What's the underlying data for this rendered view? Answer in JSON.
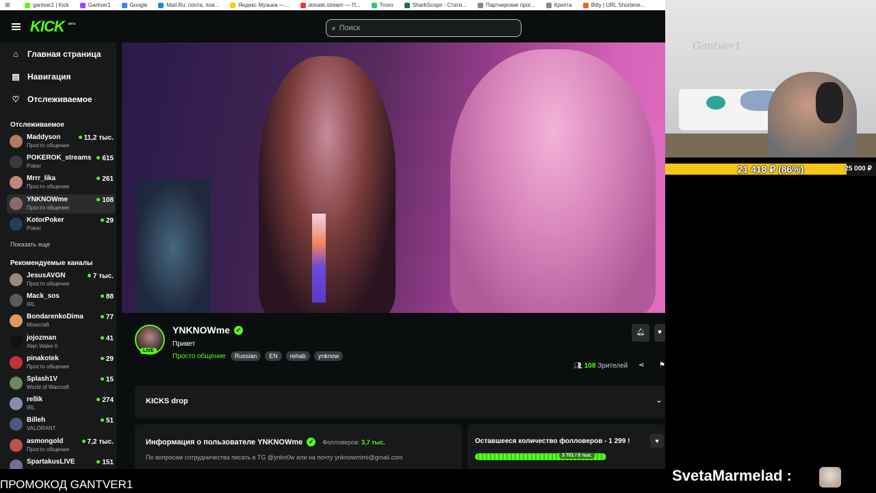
{
  "bookmarks": [
    {
      "label": "gantver1 | Kick",
      "color": "#53fc18"
    },
    {
      "label": "Gantver1",
      "color": "#9146ff"
    },
    {
      "label": "Google",
      "color": "#4285f4"
    },
    {
      "label": "Mail.Ru: почта, пои...",
      "color": "#168de2"
    },
    {
      "label": "Яндекс Музыка —...",
      "color": "#ffcc00"
    },
    {
      "label": "donate.stream — П...",
      "color": "#e53935"
    },
    {
      "label": "Trovo",
      "color": "#19d66b"
    },
    {
      "label": "SharkScope - Стати...",
      "color": "#1f6f3f"
    },
    {
      "label": "Партнерские прог...",
      "color": "#888888"
    },
    {
      "label": "Крипта",
      "color": "#888888"
    },
    {
      "label": "Bitly | URL Shortene...",
      "color": "#ee6123"
    }
  ],
  "kick": {
    "logo": "KICK",
    "beta": "BETA",
    "search_placeholder": "Поиск",
    "nav": [
      {
        "label": "Главная страница",
        "icon": "home-icon"
      },
      {
        "label": "Навигация",
        "icon": "browse-icon"
      },
      {
        "label": "Отслеживаемое",
        "icon": "heart-icon"
      }
    ],
    "following_title": "Отслеживаемое",
    "following": [
      {
        "name": "Maddyson",
        "category": "Просто общение",
        "viewers": "11,2 тыс.",
        "color": "#b07b5e"
      },
      {
        "name": "POKEROK_streams",
        "category": "Poker",
        "viewers": "615",
        "color": "#3a3a3a"
      },
      {
        "name": "Mrrr_lika",
        "category": "Просто общение",
        "viewers": "261",
        "color": "#c4847a"
      },
      {
        "name": "YNKNOWme",
        "category": "Просто общение",
        "viewers": "108",
        "color": "#8a6a6a"
      },
      {
        "name": "KotorPoker",
        "category": "Poker",
        "viewers": "29",
        "color": "#2a3a5a"
      }
    ],
    "show_more": "Показать еще",
    "recommended_title": "Рекомендуемые каналы",
    "recommended": [
      {
        "name": "JesusAVGN",
        "category": "Просто общение",
        "viewers": "7 тыс.",
        "color": "#9a8a7a"
      },
      {
        "name": "Mack_sos",
        "category": "IRL",
        "viewers": "88",
        "color": "#5a5a5a"
      },
      {
        "name": "BondarenkoDima",
        "category": "Minecraft",
        "viewers": "77",
        "color": "#d89a6a"
      },
      {
        "name": "jojozman",
        "category": "Alan Wake II",
        "viewers": "41",
        "color": "#111111"
      },
      {
        "name": "pinakotek",
        "category": "Просто общение",
        "viewers": "29",
        "color": "#c2323a"
      },
      {
        "name": "Splash1V",
        "category": "World of Warcraft",
        "viewers": "15",
        "color": "#6a8a5a"
      },
      {
        "name": "rellik",
        "category": "IRL",
        "viewers": "274",
        "color": "#8a8aaa"
      },
      {
        "name": "Billeh",
        "category": "VALORANT",
        "viewers": "51",
        "color": "#4a5a7a"
      },
      {
        "name": "asmongold",
        "category": "Просто общение",
        "viewers": "7,2 тыс.",
        "color": "#c0504a"
      },
      {
        "name": "SpartakusLIVE",
        "category": "",
        "viewers": "151",
        "color": "#7a6a9a"
      }
    ],
    "channel": {
      "name": "YNKNOWme",
      "live": "LIVE",
      "title": "Привет",
      "category": "Просто общение",
      "tags": [
        "Russian",
        "EN",
        "rehab",
        "ynknow"
      ],
      "viewers": "108",
      "viewers_label": "Зрителей"
    },
    "kicks_drop": "KICKS drop",
    "about_title": "Информация о пользователе YNKNOWme",
    "followers_label": "Фолловеров:",
    "followers_value": "3,7 тыс.",
    "about_desc": "По вопросам сотрудничества писать в TG @ynkn0w или на почту ynknowmimi@gmail.com",
    "goal_title": "Оставшееся количество фолловеров - 1 299 !",
    "goal_bar_label": "3 701 / 5 тыс.",
    "goal_progress": 0.74
  },
  "webcam": {
    "wall_text": "Gantver1"
  },
  "donation": {
    "text": "21 418 ₽ (86%)",
    "goal": "25 000 ₽",
    "progress": 0.86,
    "color": "#f5c518"
  },
  "promo": "ПРОМОКОД GANTVER1",
  "chat_user": "SvetaMarmelad :"
}
